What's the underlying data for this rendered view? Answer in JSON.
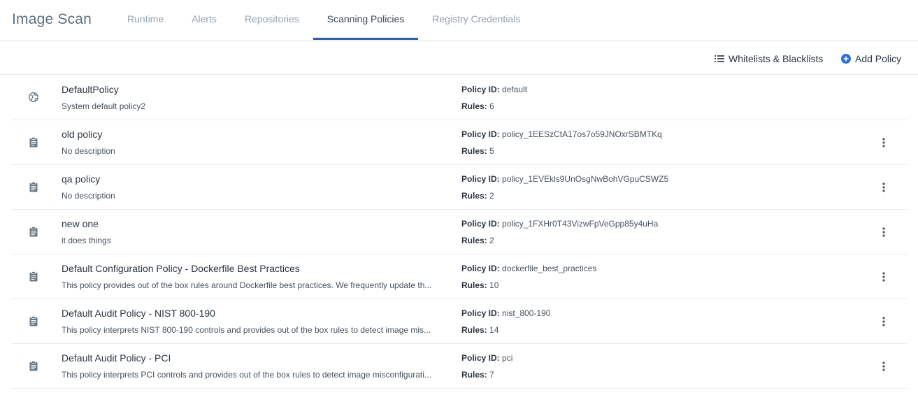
{
  "app": {
    "title": "Image Scan"
  },
  "tabs": [
    {
      "label": "Runtime"
    },
    {
      "label": "Alerts"
    },
    {
      "label": "Repositories"
    },
    {
      "label": "Scanning Policies",
      "active": true
    },
    {
      "label": "Registry Credentials"
    }
  ],
  "toolbar": {
    "lists_label": "Whitelists & Blacklists",
    "add_label": "Add Policy"
  },
  "labels": {
    "policy_id": "Policy ID:",
    "rules": "Rules:"
  },
  "colors": {
    "accent": "#2e5faa",
    "add_icon": "#2f6fd8",
    "icon": "#6b7882"
  },
  "policies": [
    {
      "icon": "globe-icon",
      "name": "DefaultPolicy",
      "description": "System default policy2",
      "policy_id": "default",
      "rules": "6",
      "has_menu": false
    },
    {
      "icon": "clipboard-icon",
      "name": "old policy",
      "description": "No description",
      "policy_id": "policy_1EESzCtA17os7o59JNOxrSBMTKq",
      "rules": "5",
      "has_menu": true
    },
    {
      "icon": "clipboard-icon",
      "name": "qa policy",
      "description": "No description",
      "policy_id": "policy_1EVEkls9UnOsgNwBohVGpuCSWZ5",
      "rules": "2",
      "has_menu": true
    },
    {
      "icon": "clipboard-icon",
      "name": "new one",
      "description": "it does things",
      "policy_id": "policy_1FXHr0T43VizwFpVeGpp85y4uHa",
      "rules": "2",
      "has_menu": true
    },
    {
      "icon": "clipboard-icon",
      "name": "Default Configuration Policy - Dockerfile Best Practices",
      "description": "This policy provides out of the box rules around Dockerfile best practices. We frequently update th...",
      "policy_id": "dockerfile_best_practices",
      "rules": "10",
      "has_menu": true
    },
    {
      "icon": "clipboard-icon",
      "name": "Default Audit Policy - NIST 800-190",
      "description": "This policy interprets NIST 800-190 controls and provides out of the box rules to detect image mis...",
      "policy_id": "nist_800-190",
      "rules": "14",
      "has_menu": true
    },
    {
      "icon": "clipboard-icon",
      "name": "Default Audit Policy - PCI",
      "description": "This policy interprets PCI controls and provides out of the box rules to detect image misconfigurati...",
      "policy_id": "pci",
      "rules": "7",
      "has_menu": true
    }
  ]
}
